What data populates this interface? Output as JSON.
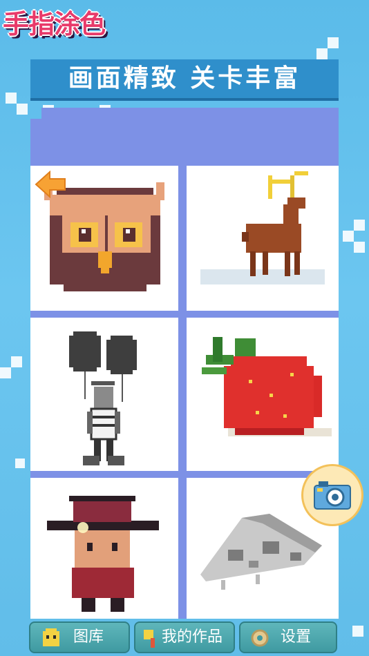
{
  "header": {
    "logo_text": "手指涂色"
  },
  "banner": {
    "text": "画面精致 关卡丰富"
  },
  "gallery": {
    "items": [
      {
        "name": "owl"
      },
      {
        "name": "deer"
      },
      {
        "name": "balloon-boy"
      },
      {
        "name": "strawberry"
      },
      {
        "name": "hat-man"
      },
      {
        "name": "pizza-slice"
      }
    ]
  },
  "bottom_nav": {
    "tabs": [
      {
        "label": "图库",
        "icon": "ghost-icon"
      },
      {
        "label": "我的作品",
        "icon": "paintbrush-icon"
      },
      {
        "label": "设置",
        "icon": "gear-icon"
      }
    ]
  },
  "floating": {
    "camera_icon": "camera-icon"
  }
}
